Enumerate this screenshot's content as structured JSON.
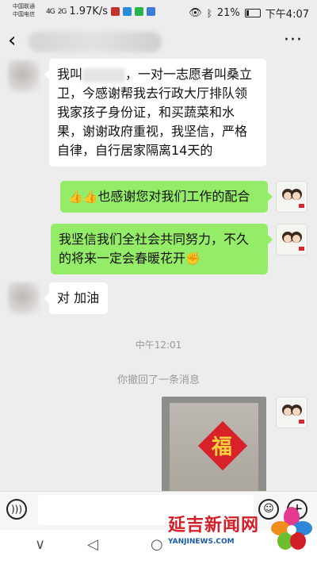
{
  "status_bar": {
    "carrier1": "中国联通",
    "carrier2": "中国电信",
    "network": "4G",
    "network2": "2G",
    "speed": "1.97K/s",
    "battery": "21%",
    "battery_level": 0.21,
    "time": "下午4:07"
  },
  "nav": {
    "back_icon": "chevron-left-icon",
    "more_icon": "more-dots-icon",
    "more_glyph": "···"
  },
  "messages": [
    {
      "side": "in",
      "text_prefix": "我叫",
      "text_rest": "，一对一志愿者叫桑立卫，今感谢帮我去行政大厅排队领我家孩子身份证，和买蔬菜和水果，谢谢政府重视，我坚信，严格自律，自行居家隔离14天的"
    },
    {
      "side": "out",
      "emoji": "👍👍",
      "text": "也感谢您对我们工作的配合"
    },
    {
      "side": "out",
      "text": "我坚信我们全社会共同努力，不久的将来一定会春暖花开",
      "emoji": "✊"
    },
    {
      "side": "in",
      "text": "对 加油"
    }
  ],
  "timestamp": "中午12:01",
  "system_notice": "你撤回了一条消息",
  "photo": {
    "char": "福"
  },
  "input_bar": {
    "voice_icon": "voice-icon",
    "emoji_icon": "emoji-icon",
    "plus_icon": "plus-icon"
  },
  "system_nav": {
    "back": "◁",
    "home": "○",
    "recents": "□",
    "down": "∨"
  },
  "watermark": {
    "title": "延吉新闻网",
    "url": "YANJINEWS.COM"
  }
}
